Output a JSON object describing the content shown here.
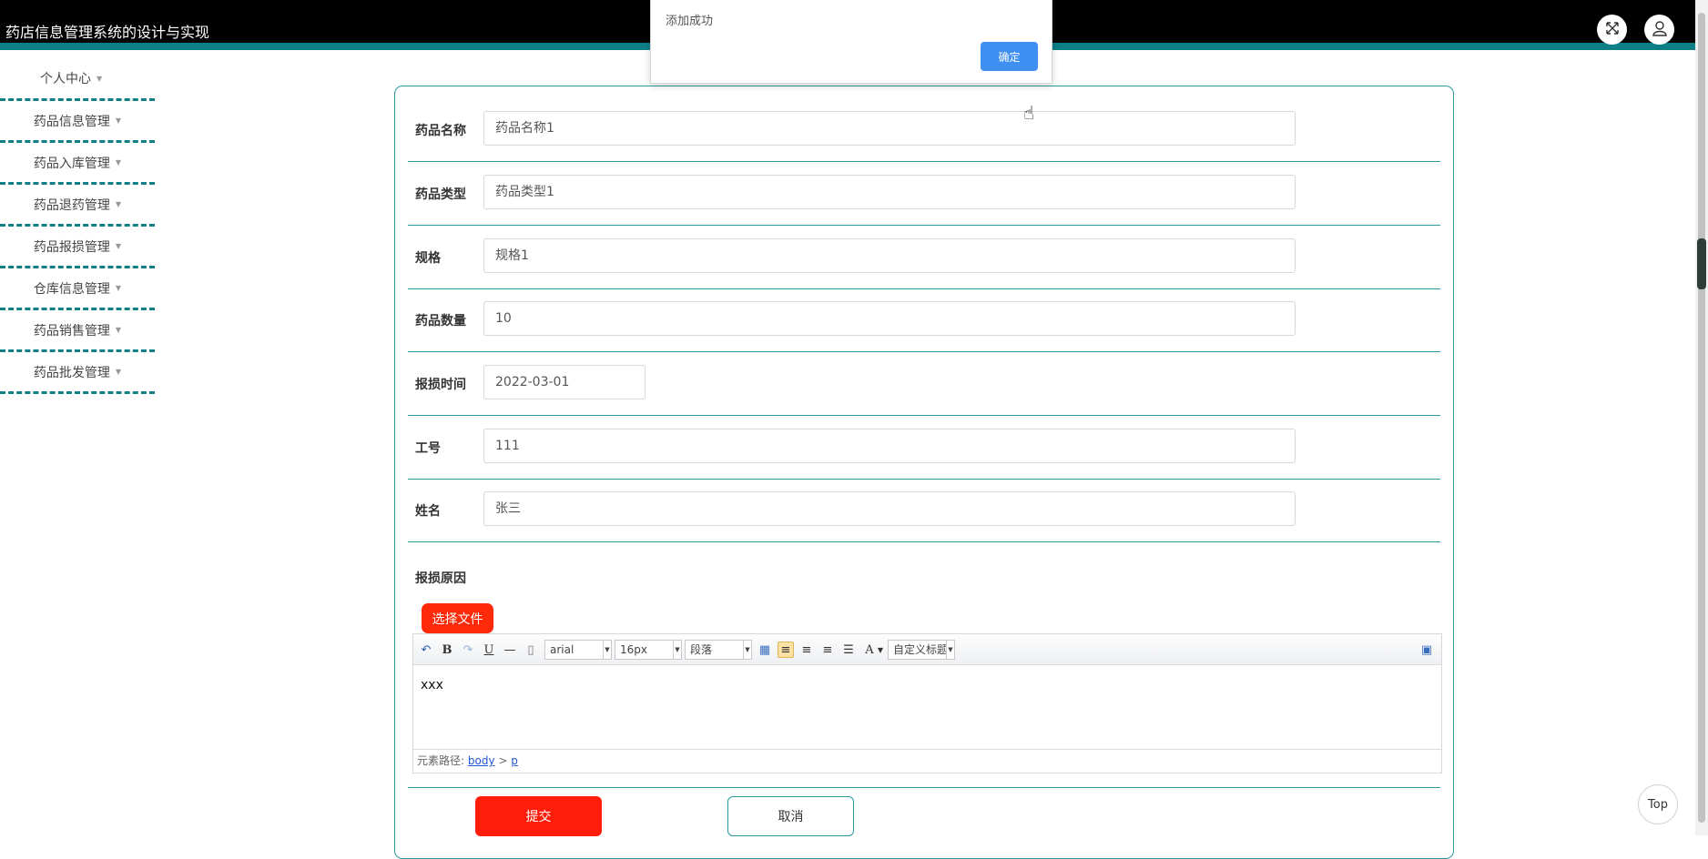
{
  "header": {
    "title": "药店信息管理系统的设计与实现",
    "fullscreen_icon": "fullscreen-icon",
    "user_icon": "user-icon"
  },
  "sidebar": {
    "items": [
      {
        "label": "个人中心"
      },
      {
        "label": "药品信息管理"
      },
      {
        "label": "药品入库管理"
      },
      {
        "label": "药品退药管理"
      },
      {
        "label": "药品报损管理"
      },
      {
        "label": "仓库信息管理"
      },
      {
        "label": "药品销售管理"
      },
      {
        "label": "药品批发管理"
      }
    ]
  },
  "form": {
    "fields": [
      {
        "label": "药品名称",
        "value": "药品名称1"
      },
      {
        "label": "药品类型",
        "value": "药品类型1"
      },
      {
        "label": "规格",
        "value": "规格1"
      },
      {
        "label": "药品数量",
        "value": "10"
      },
      {
        "label": "报损时间",
        "value": "2022-03-01"
      },
      {
        "label": "工号",
        "value": "111"
      },
      {
        "label": "姓名",
        "value": "张三"
      }
    ],
    "reason_label": "报损原因",
    "choose_file_label": "选择文件",
    "editor": {
      "font_family": "arial",
      "font_size": "16px",
      "paragraph": "段落",
      "custom_title": "自定义标题",
      "content": "xxx",
      "path_label": "元素路径:",
      "path_body": "body",
      "path_sep": ">",
      "path_p": "p"
    },
    "submit_label": "提交",
    "cancel_label": "取消"
  },
  "dialog": {
    "message": "添加成功",
    "ok_label": "确定"
  },
  "back_to_top_label": "Top",
  "colors": {
    "accent_teal": "#0e7f87",
    "submit_red": "#ff1c0a",
    "dialog_blue": "#3f8ef2"
  }
}
